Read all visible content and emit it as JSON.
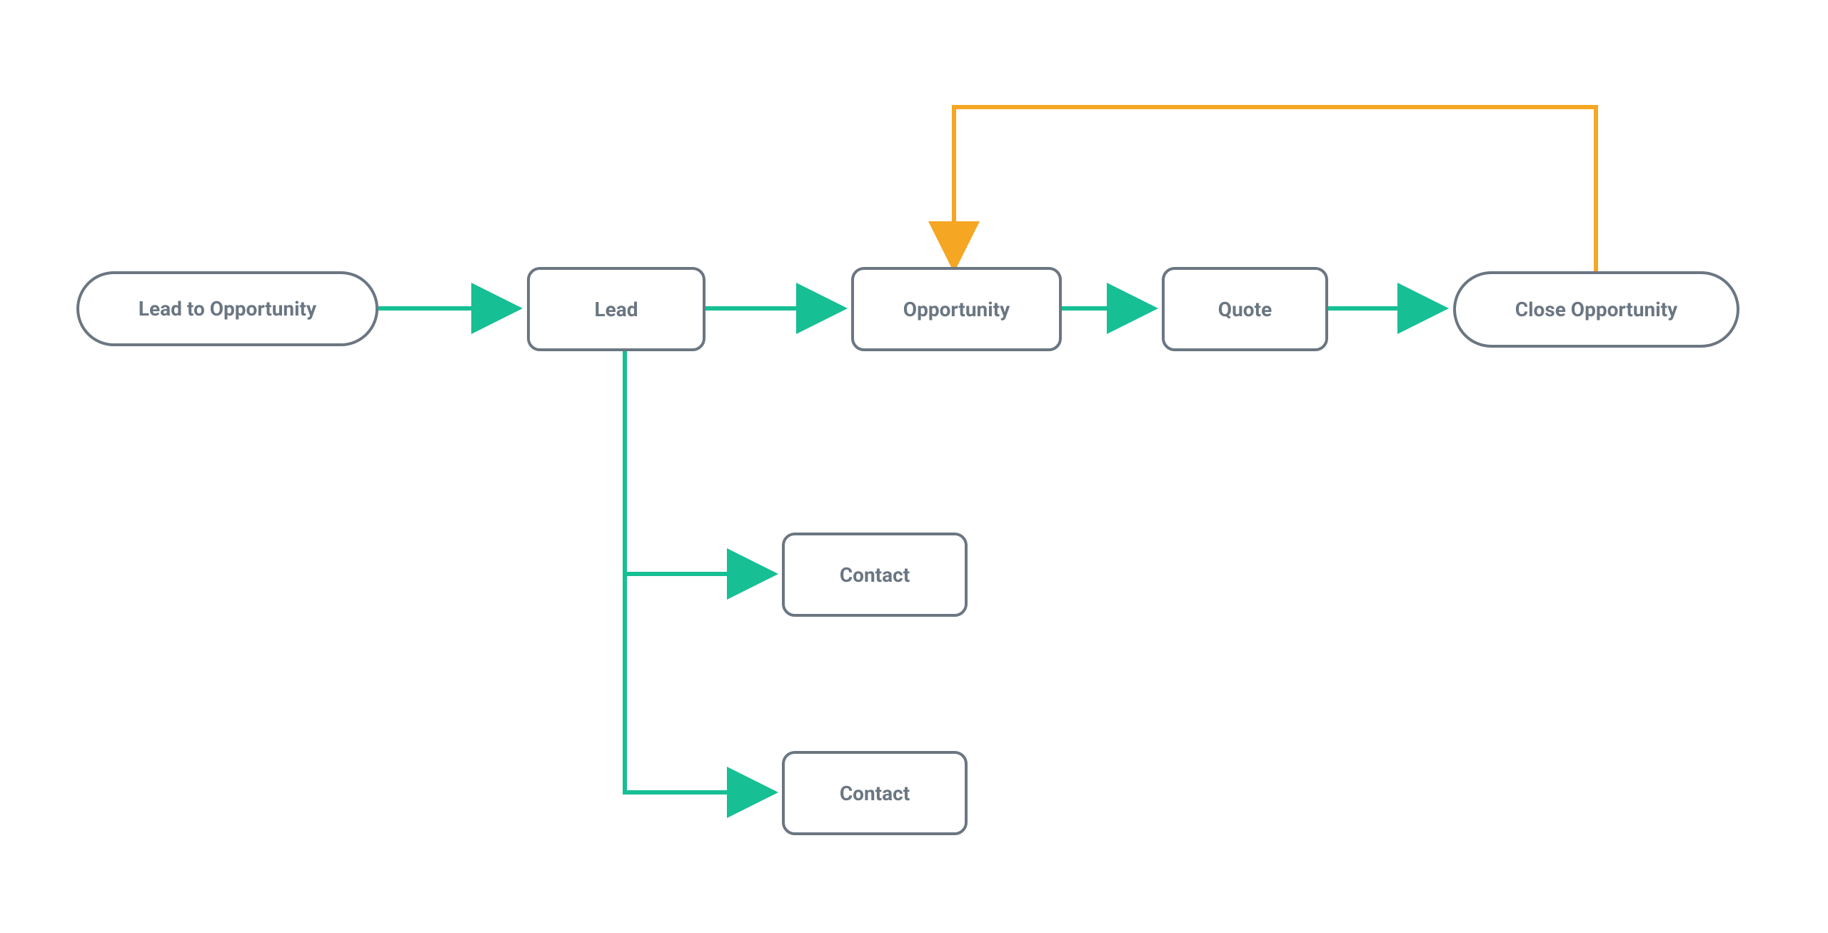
{
  "nodes": {
    "lead_to_opportunity": "Lead to Opportunity",
    "lead": "Lead",
    "opportunity": "Opportunity",
    "quote": "Quote",
    "close_opportunity": "Close Opportunity",
    "contact_1": "Contact",
    "contact_2": "Contact"
  },
  "colors": {
    "node_border": "#6b7682",
    "node_text": "#6b7682",
    "arrow_forward": "#16bf94",
    "arrow_loop": "#f5a623"
  },
  "diagram_meta": {
    "type": "flowchart",
    "edges": [
      {
        "from": "lead_to_opportunity",
        "to": "lead",
        "color": "forward"
      },
      {
        "from": "lead",
        "to": "opportunity",
        "color": "forward"
      },
      {
        "from": "opportunity",
        "to": "quote",
        "color": "forward"
      },
      {
        "from": "quote",
        "to": "close_opportunity",
        "color": "forward"
      },
      {
        "from": "lead",
        "to": "contact_1",
        "color": "forward"
      },
      {
        "from": "lead",
        "to": "contact_2",
        "color": "forward"
      },
      {
        "from": "close_opportunity",
        "to": "opportunity",
        "color": "loop"
      }
    ]
  }
}
